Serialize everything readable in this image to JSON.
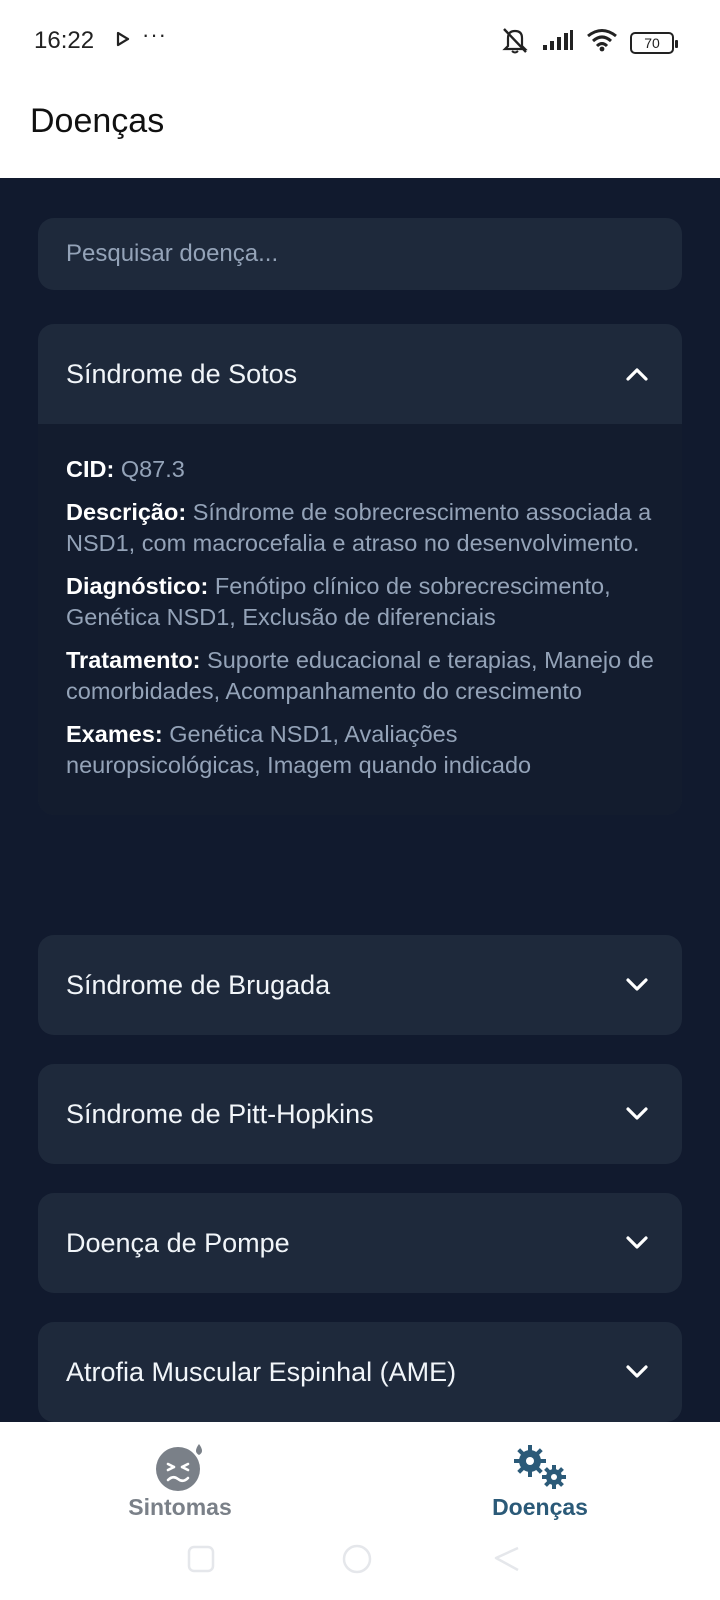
{
  "status_bar": {
    "time": "16:22",
    "dots": "···",
    "battery": "70",
    "icons": [
      "play-icon",
      "bell-mute-icon",
      "signal-icon",
      "wifi-icon",
      "battery-icon"
    ]
  },
  "app_bar": {
    "title": "Doenças"
  },
  "search": {
    "placeholder": "Pesquisar doença..."
  },
  "diseases": [
    {
      "name": "Síndrome de Sotos",
      "expanded": true,
      "details": {
        "cid_label": "CID:",
        "cid": "Q87.3",
        "descricao_label": "Descrição:",
        "descricao": "Síndrome de sobrecrescimento associada a NSD1, com macrocefalia e atraso no desenvolvimento.",
        "diagnostico_label": "Diagnóstico:",
        "diagnostico": "Fenótipo clínico de sobrecrescimento, Genética NSD1, Exclusão de diferenciais",
        "tratamento_label": "Tratamento:",
        "tratamento": "Suporte educacional e terapias, Manejo de comorbidades, Acompanhamento do crescimento",
        "exames_label": "Exames:",
        "exames": "Genética NSD1, Avaliações neuropsicológicas, Imagem quando indicado"
      }
    },
    {
      "name": "Síndrome de Brugada",
      "expanded": false
    },
    {
      "name": "Síndrome de Pitt-Hopkins",
      "expanded": false
    },
    {
      "name": "Doença de Pompe",
      "expanded": false
    },
    {
      "name": "Atrofia Muscular Espinhal (AME)",
      "expanded": false
    }
  ],
  "bottom_nav": {
    "items": [
      {
        "label": "Sintomas",
        "icon": "sick-face-icon",
        "active": false
      },
      {
        "label": "Doenças",
        "icon": "virus-gears-icon",
        "active": true
      }
    ]
  },
  "colors": {
    "background": "#111a2e",
    "card": "#1e293b",
    "active_nav": "#2b5a78",
    "inactive_nav": "#7a8088"
  }
}
